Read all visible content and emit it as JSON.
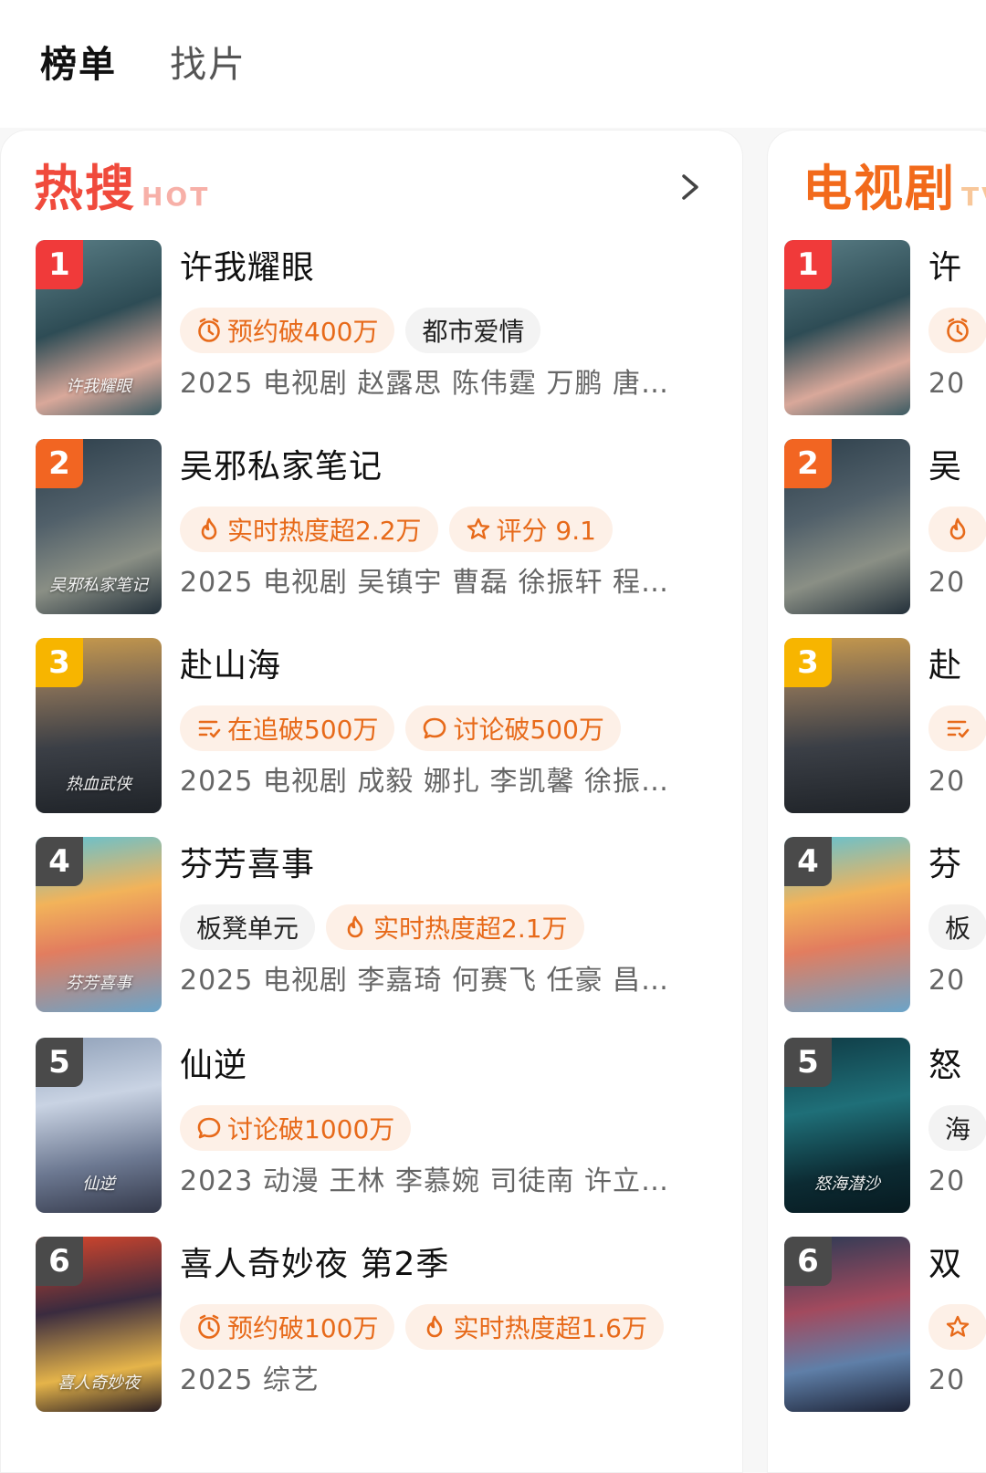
{
  "top_tabs": [
    {
      "label": "榜单",
      "active": true
    },
    {
      "label": "找片",
      "active": false
    }
  ],
  "colors": {
    "hot_title": "#f04a3c",
    "tv_title": "#f26a1b",
    "rank_1": "#f03a3a",
    "rank_2": "#f26522",
    "rank_3": "#f7b500",
    "rank_other": "#4a4a4a",
    "tag_bg": "#fdf0e7",
    "tag_text": "#e76a1a"
  },
  "hot": {
    "title": "热搜",
    "subtitle": "HOT",
    "more_icon": "chevron-right-icon",
    "items": [
      {
        "rank": "1",
        "title": "许我耀眼",
        "tags": [
          {
            "icon": "clock-icon",
            "text": "预约破400万",
            "style": "hot"
          },
          {
            "icon": "",
            "text": "都市爱情",
            "style": "genre"
          }
        ],
        "meta": "2025 电视剧 赵露思 陈伟霆 万鹏 唐…",
        "poster_text": "许我耀眼"
      },
      {
        "rank": "2",
        "title": "吴邪私家笔记",
        "tags": [
          {
            "icon": "flame-icon",
            "text": "实时热度超2.2万",
            "style": "hot"
          },
          {
            "icon": "star-icon",
            "text": "评分 9.1",
            "style": "hot"
          }
        ],
        "meta": "2025 电视剧 吴镇宇 曹磊 徐振轩 程…",
        "poster_text": "吴邪私家笔记"
      },
      {
        "rank": "3",
        "title": "赴山海",
        "tags": [
          {
            "icon": "list-icon",
            "text": "在追破500万",
            "style": "hot"
          },
          {
            "icon": "chat-icon",
            "text": "讨论破500万",
            "style": "hot"
          }
        ],
        "meta": "2025 电视剧 成毅 娜扎 李凯馨 徐振…",
        "poster_text": "热血武侠"
      },
      {
        "rank": "4",
        "title": "芬芳喜事",
        "tags": [
          {
            "icon": "",
            "text": "板凳单元",
            "style": "genre"
          },
          {
            "icon": "flame-icon",
            "text": "实时热度超2.1万",
            "style": "hot"
          }
        ],
        "meta": "2025 电视剧 李嘉琦 何赛飞 任豪 昌…",
        "poster_text": "芬芳喜事"
      },
      {
        "rank": "5",
        "title": "仙逆",
        "tags": [
          {
            "icon": "chat-icon",
            "text": "讨论破1000万",
            "style": "hot"
          }
        ],
        "meta": "2023 动漫 王林 李慕婉 司徒南 许立…",
        "poster_text": "仙逆"
      },
      {
        "rank": "6",
        "title": "喜人奇妙夜 第2季",
        "tags": [
          {
            "icon": "clock-icon",
            "text": "预约破100万",
            "style": "hot"
          },
          {
            "icon": "flame-icon",
            "text": "实时热度超1.6万",
            "style": "hot"
          }
        ],
        "meta": "2025 综艺",
        "poster_text": "喜人奇妙夜"
      }
    ]
  },
  "tv": {
    "title": "电视剧",
    "subtitle": "TV",
    "items": [
      {
        "rank": "1",
        "title": "许",
        "tag_icon": "clock-icon",
        "meta": "20"
      },
      {
        "rank": "2",
        "title": "吴",
        "tag_icon": "flame-icon",
        "meta": "20"
      },
      {
        "rank": "3",
        "title": "赴",
        "tag_icon": "list-icon",
        "meta": "20"
      },
      {
        "rank": "4",
        "title": "芬",
        "tag_text": "板",
        "meta": "20"
      },
      {
        "rank": "5",
        "title": "怒",
        "tag_text": "海",
        "meta": "20",
        "poster_text": "怒海潜沙"
      },
      {
        "rank": "6",
        "title": "双",
        "tag_icon": "star-icon",
        "meta": "20"
      }
    ]
  }
}
